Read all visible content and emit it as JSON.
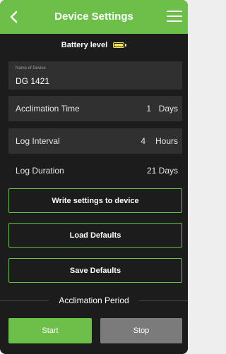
{
  "header": {
    "title": "Device Settings",
    "back_icon": "chevron-left-icon",
    "menu_icon": "hamburger-menu-icon"
  },
  "battery": {
    "label": "Battery level",
    "icon": "battery-icon",
    "color": "#f2e35a"
  },
  "device_name": {
    "label": "Name of Device",
    "value": "DG 1421"
  },
  "settings": {
    "acclimation": {
      "label": "Acclimation Time",
      "value": "1",
      "unit": "Days"
    },
    "log_interval": {
      "label": "Log Interval",
      "value": "4",
      "unit": "Hours"
    },
    "log_duration": {
      "label": "Log Duration",
      "value": "21 Days"
    }
  },
  "buttons": {
    "write": "Write settings to device",
    "load_defaults": "Load Defaults",
    "save_defaults": "Save Defaults",
    "start": "Start",
    "stop": "Stop"
  },
  "section": {
    "acclimation_period": "Acclimation Period"
  },
  "colors": {
    "accent": "#6cc04a",
    "background": "#1c1c1c",
    "field": "#303030",
    "stop_button": "#7b7b7b"
  }
}
